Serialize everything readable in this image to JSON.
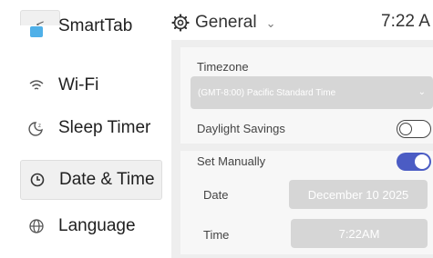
{
  "header": {
    "back_label": "<",
    "title": "General",
    "title_chevron": "⌄",
    "clock": "7:22 A"
  },
  "sidebar": {
    "items": [
      {
        "label": "SmartTab",
        "icon": "tab-icon"
      },
      {
        "label": "Wi-Fi",
        "icon": "wifi-icon"
      },
      {
        "label": "Sleep Timer",
        "icon": "sleep-icon"
      },
      {
        "label": "Date & Time",
        "icon": "clock-icon",
        "active": true
      },
      {
        "label": "Language",
        "icon": "globe-icon"
      }
    ]
  },
  "settings": {
    "timezone_label": "Timezone",
    "timezone_value": "(GMT-8:00) Pacific Standard Time",
    "daylight_label": "Daylight Savings",
    "daylight_on": false,
    "manual_label": "Set Manually",
    "manual_on": true,
    "date_label": "Date",
    "date_value": "December 10 2025",
    "time_label": "Time",
    "time_value": "7:22AM"
  },
  "colors": {
    "accent": "#4b5cc4",
    "panel_bg": "#eeeeee",
    "field_bg": "#d6d6d6"
  }
}
